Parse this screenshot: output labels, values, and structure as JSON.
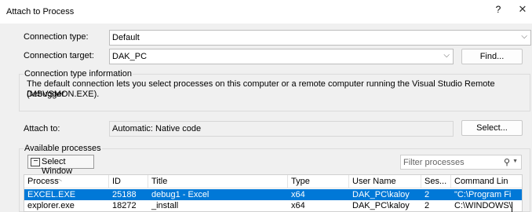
{
  "window": {
    "title": "Attach to Process",
    "help_label": "?",
    "close_label": "✕"
  },
  "connection": {
    "type_label": "Connection type:",
    "type_value": "Default",
    "target_label": "Connection target:",
    "target_value": "DAK_PC",
    "find_button": "Find..."
  },
  "info": {
    "legend": "Connection type information",
    "line1": "The default connection lets you select processes on this computer or a remote computer running the Visual Studio Remote Debugger",
    "line2": "(MSVSMON.EXE)."
  },
  "attach": {
    "label": "Attach to:",
    "value": "Automatic: Native code",
    "select_button": "Select..."
  },
  "processes": {
    "legend": "Available processes",
    "select_window_button": "Select Window",
    "filter_placeholder": "Filter processes",
    "columns": [
      "Process",
      "ID",
      "Title",
      "Type",
      "User Name",
      "Ses...",
      "Command Lin"
    ],
    "rows": [
      {
        "process": "EXCEL.EXE",
        "id": "25188",
        "title": "debug1 - Excel",
        "type": "x64",
        "user": "DAK_PC\\kaloy",
        "session": "2",
        "command": "\"C:\\Program Fi",
        "selected": true
      },
      {
        "process": "explorer.exe",
        "id": "18272",
        "title": "_install",
        "type": "x64",
        "user": "DAK_PC\\kaloy",
        "session": "2",
        "command": "C:\\WINDOWS\\",
        "selected": false
      }
    ]
  },
  "icons": [
    "chevron-down-icon",
    "search-icon",
    "select-window-icon",
    "sort-up-icon",
    "close-icon"
  ]
}
